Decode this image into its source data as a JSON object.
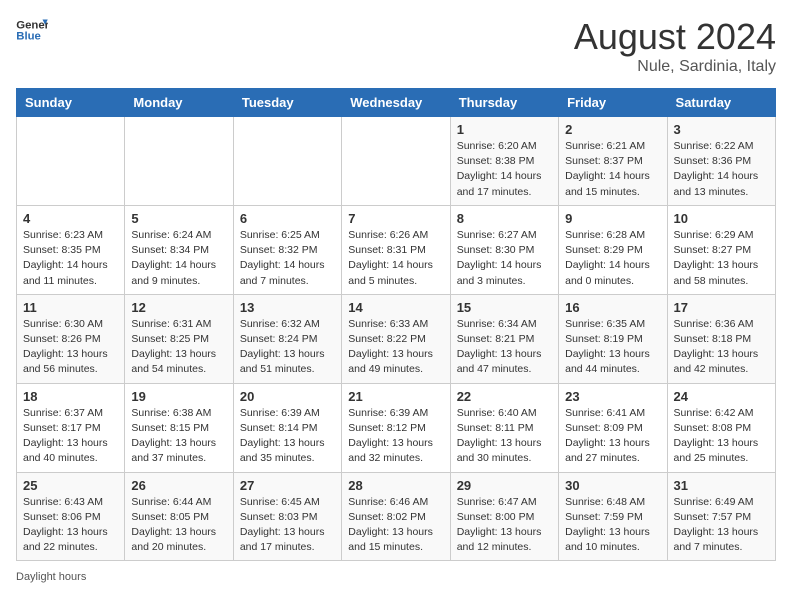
{
  "header": {
    "logo_general": "General",
    "logo_blue": "Blue",
    "month_year": "August 2024",
    "location": "Nule, Sardinia, Italy"
  },
  "days_of_week": [
    "Sunday",
    "Monday",
    "Tuesday",
    "Wednesday",
    "Thursday",
    "Friday",
    "Saturday"
  ],
  "weeks": [
    [
      {
        "day": "",
        "info": ""
      },
      {
        "day": "",
        "info": ""
      },
      {
        "day": "",
        "info": ""
      },
      {
        "day": "",
        "info": ""
      },
      {
        "day": "1",
        "info": "Sunrise: 6:20 AM\nSunset: 8:38 PM\nDaylight: 14 hours and 17 minutes."
      },
      {
        "day": "2",
        "info": "Sunrise: 6:21 AM\nSunset: 8:37 PM\nDaylight: 14 hours and 15 minutes."
      },
      {
        "day": "3",
        "info": "Sunrise: 6:22 AM\nSunset: 8:36 PM\nDaylight: 14 hours and 13 minutes."
      }
    ],
    [
      {
        "day": "4",
        "info": "Sunrise: 6:23 AM\nSunset: 8:35 PM\nDaylight: 14 hours and 11 minutes."
      },
      {
        "day": "5",
        "info": "Sunrise: 6:24 AM\nSunset: 8:34 PM\nDaylight: 14 hours and 9 minutes."
      },
      {
        "day": "6",
        "info": "Sunrise: 6:25 AM\nSunset: 8:32 PM\nDaylight: 14 hours and 7 minutes."
      },
      {
        "day": "7",
        "info": "Sunrise: 6:26 AM\nSunset: 8:31 PM\nDaylight: 14 hours and 5 minutes."
      },
      {
        "day": "8",
        "info": "Sunrise: 6:27 AM\nSunset: 8:30 PM\nDaylight: 14 hours and 3 minutes."
      },
      {
        "day": "9",
        "info": "Sunrise: 6:28 AM\nSunset: 8:29 PM\nDaylight: 14 hours and 0 minutes."
      },
      {
        "day": "10",
        "info": "Sunrise: 6:29 AM\nSunset: 8:27 PM\nDaylight: 13 hours and 58 minutes."
      }
    ],
    [
      {
        "day": "11",
        "info": "Sunrise: 6:30 AM\nSunset: 8:26 PM\nDaylight: 13 hours and 56 minutes."
      },
      {
        "day": "12",
        "info": "Sunrise: 6:31 AM\nSunset: 8:25 PM\nDaylight: 13 hours and 54 minutes."
      },
      {
        "day": "13",
        "info": "Sunrise: 6:32 AM\nSunset: 8:24 PM\nDaylight: 13 hours and 51 minutes."
      },
      {
        "day": "14",
        "info": "Sunrise: 6:33 AM\nSunset: 8:22 PM\nDaylight: 13 hours and 49 minutes."
      },
      {
        "day": "15",
        "info": "Sunrise: 6:34 AM\nSunset: 8:21 PM\nDaylight: 13 hours and 47 minutes."
      },
      {
        "day": "16",
        "info": "Sunrise: 6:35 AM\nSunset: 8:19 PM\nDaylight: 13 hours and 44 minutes."
      },
      {
        "day": "17",
        "info": "Sunrise: 6:36 AM\nSunset: 8:18 PM\nDaylight: 13 hours and 42 minutes."
      }
    ],
    [
      {
        "day": "18",
        "info": "Sunrise: 6:37 AM\nSunset: 8:17 PM\nDaylight: 13 hours and 40 minutes."
      },
      {
        "day": "19",
        "info": "Sunrise: 6:38 AM\nSunset: 8:15 PM\nDaylight: 13 hours and 37 minutes."
      },
      {
        "day": "20",
        "info": "Sunrise: 6:39 AM\nSunset: 8:14 PM\nDaylight: 13 hours and 35 minutes."
      },
      {
        "day": "21",
        "info": "Sunrise: 6:39 AM\nSunset: 8:12 PM\nDaylight: 13 hours and 32 minutes."
      },
      {
        "day": "22",
        "info": "Sunrise: 6:40 AM\nSunset: 8:11 PM\nDaylight: 13 hours and 30 minutes."
      },
      {
        "day": "23",
        "info": "Sunrise: 6:41 AM\nSunset: 8:09 PM\nDaylight: 13 hours and 27 minutes."
      },
      {
        "day": "24",
        "info": "Sunrise: 6:42 AM\nSunset: 8:08 PM\nDaylight: 13 hours and 25 minutes."
      }
    ],
    [
      {
        "day": "25",
        "info": "Sunrise: 6:43 AM\nSunset: 8:06 PM\nDaylight: 13 hours and 22 minutes."
      },
      {
        "day": "26",
        "info": "Sunrise: 6:44 AM\nSunset: 8:05 PM\nDaylight: 13 hours and 20 minutes."
      },
      {
        "day": "27",
        "info": "Sunrise: 6:45 AM\nSunset: 8:03 PM\nDaylight: 13 hours and 17 minutes."
      },
      {
        "day": "28",
        "info": "Sunrise: 6:46 AM\nSunset: 8:02 PM\nDaylight: 13 hours and 15 minutes."
      },
      {
        "day": "29",
        "info": "Sunrise: 6:47 AM\nSunset: 8:00 PM\nDaylight: 13 hours and 12 minutes."
      },
      {
        "day": "30",
        "info": "Sunrise: 6:48 AM\nSunset: 7:59 PM\nDaylight: 13 hours and 10 minutes."
      },
      {
        "day": "31",
        "info": "Sunrise: 6:49 AM\nSunset: 7:57 PM\nDaylight: 13 hours and 7 minutes."
      }
    ]
  ],
  "footer": {
    "daylight_label": "Daylight hours"
  }
}
